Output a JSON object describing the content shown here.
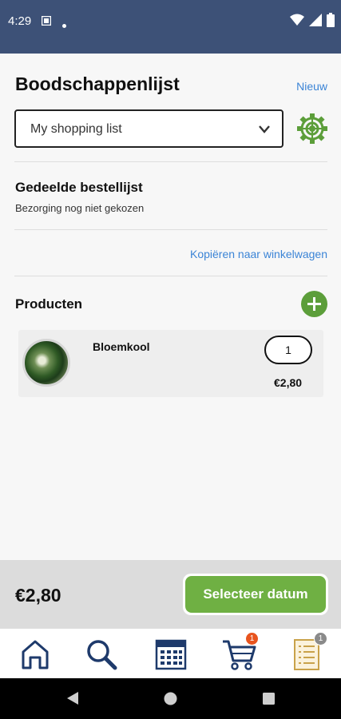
{
  "status_bar": {
    "time": "4:29"
  },
  "header": {
    "title": "Boodschappenlijst",
    "new_link": "Nieuw"
  },
  "list_select": {
    "value": "My shopping list"
  },
  "shared_section": {
    "title": "Gedeelde bestellijst",
    "subtitle": "Bezorging nog niet gekozen",
    "copy_link": "Kopiëren naar winkelwagen"
  },
  "products_section": {
    "title": "Producten",
    "items": [
      {
        "name": "Bloemkool",
        "quantity": "1",
        "price": "€2,80"
      }
    ]
  },
  "footer": {
    "total": "€2,80",
    "cta_label": "Selecteer datum"
  },
  "tab_bar": {
    "cart_badge": "1",
    "list_badge": "1"
  },
  "colors": {
    "status_bar": "#3d5177",
    "link": "#3b84d6",
    "green": "#6fb043",
    "nav_icon": "#1e3a6b",
    "cart_badge": "#e8541e",
    "list_badge": "#8a8a8a"
  }
}
